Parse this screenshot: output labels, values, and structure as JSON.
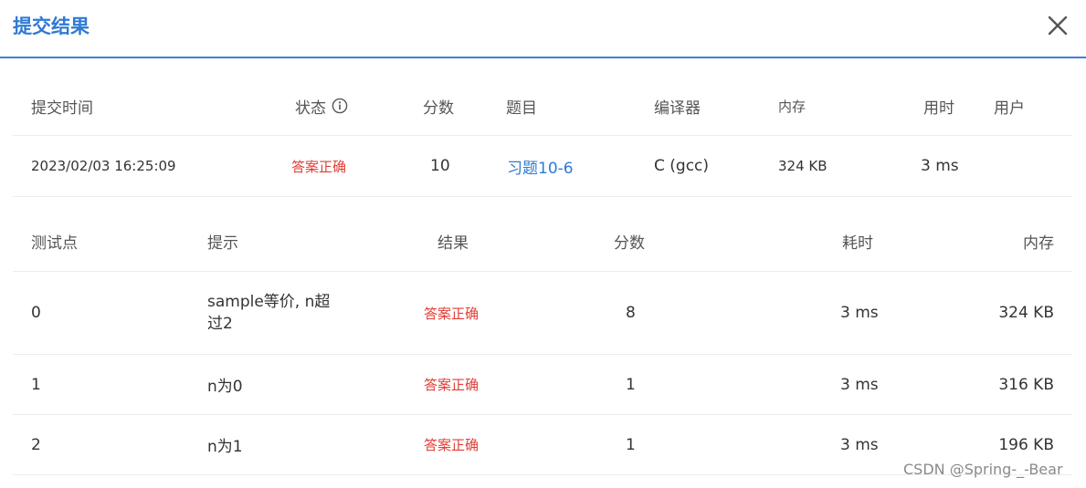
{
  "dialog": {
    "title": "提交结果",
    "close_icon": "close-icon"
  },
  "summary": {
    "headers": {
      "time": "提交时间",
      "status": "状态",
      "score": "分数",
      "problem": "题目",
      "compiler": "编译器",
      "memory": "内存",
      "duration": "用时",
      "user": "用户"
    },
    "row": {
      "time": "2023/02/03 16:25:09",
      "status": "答案正确",
      "score": "10",
      "problem": "习题10-6",
      "compiler": "C (gcc)",
      "memory": "324 KB",
      "duration": "3 ms",
      "user": ""
    }
  },
  "tests": {
    "headers": {
      "case": "测试点",
      "hint": "提示",
      "result": "结果",
      "score": "分数",
      "time": "耗时",
      "memory": "内存"
    },
    "rows": [
      {
        "case": "0",
        "hint": "sample等价, n超过2",
        "result": "答案正确",
        "score": "8",
        "time": "3 ms",
        "memory": "324 KB"
      },
      {
        "case": "1",
        "hint": "n为0",
        "result": "答案正确",
        "score": "1",
        "time": "3 ms",
        "memory": "316 KB"
      },
      {
        "case": "2",
        "hint": "n为1",
        "result": "答案正确",
        "score": "1",
        "time": "3 ms",
        "memory": "196 KB"
      }
    ]
  },
  "watermark": "CSDN @Spring-_-Bear",
  "colors": {
    "accent": "#2f7ad3",
    "ok": "#e03e36"
  }
}
